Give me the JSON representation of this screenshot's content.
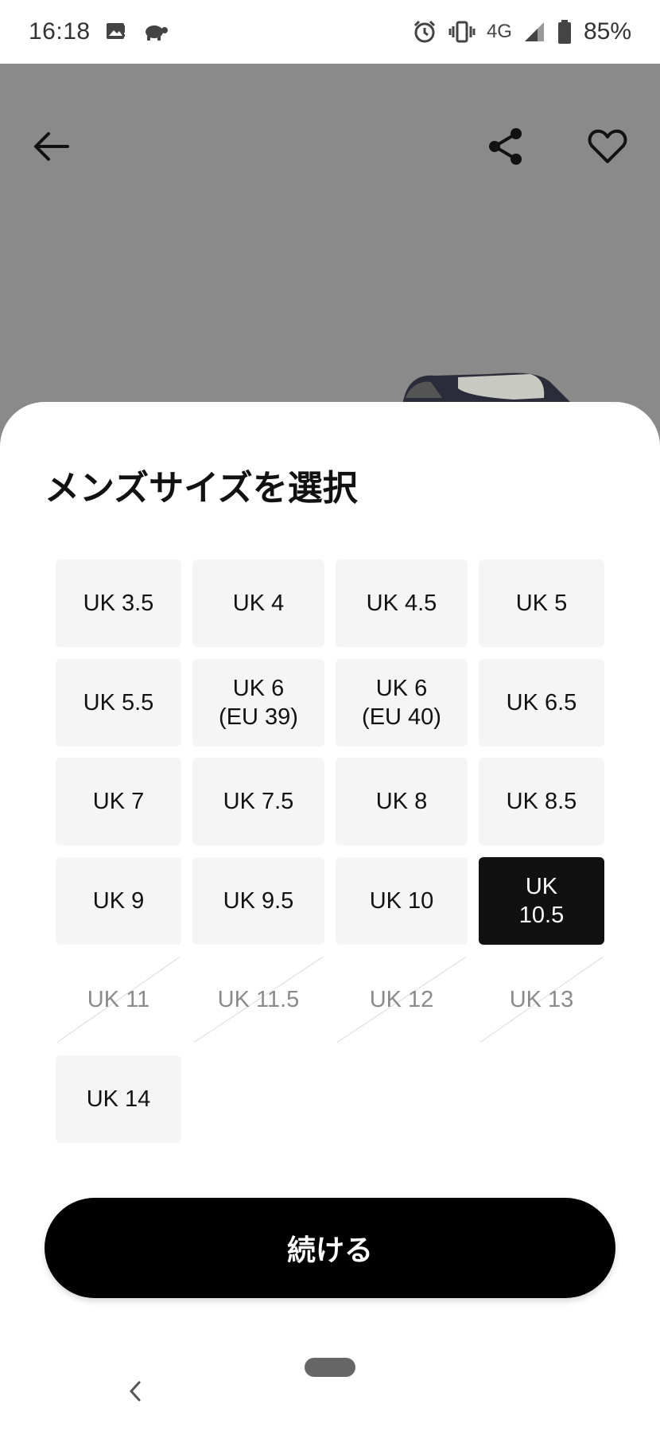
{
  "status_bar": {
    "time": "16:18",
    "network": "4G",
    "battery": "85%",
    "icons": [
      "image-icon",
      "turtle-icon",
      "alarm-icon",
      "vibrate-icon",
      "signal-icon",
      "battery-icon"
    ]
  },
  "hero": {
    "icons": [
      "arrow-left-icon",
      "share-icon",
      "heart-outline-icon"
    ]
  },
  "sheet": {
    "title": "メンズサイズを選択",
    "sizes": [
      {
        "label": "UK 3.5",
        "state": "available"
      },
      {
        "label": "UK 4",
        "state": "available"
      },
      {
        "label": "UK 4.5",
        "state": "available"
      },
      {
        "label": "UK 5",
        "state": "available"
      },
      {
        "label": "UK 5.5",
        "state": "available"
      },
      {
        "label": "UK 6\n(EU 39)",
        "state": "available"
      },
      {
        "label": "UK 6\n(EU 40)",
        "state": "available"
      },
      {
        "label": "UK 6.5",
        "state": "available"
      },
      {
        "label": "UK 7",
        "state": "available"
      },
      {
        "label": "UK 7.5",
        "state": "available"
      },
      {
        "label": "UK 8",
        "state": "available"
      },
      {
        "label": "UK 8.5",
        "state": "available"
      },
      {
        "label": "UK 9",
        "state": "available"
      },
      {
        "label": "UK 9.5",
        "state": "available"
      },
      {
        "label": "UK 10",
        "state": "available"
      },
      {
        "label": "UK\n10.5",
        "state": "selected"
      },
      {
        "label": "UK 11",
        "state": "sold-out"
      },
      {
        "label": "UK 11.5",
        "state": "sold-out"
      },
      {
        "label": "UK 12",
        "state": "sold-out"
      },
      {
        "label": "UK 13",
        "state": "sold-out"
      },
      {
        "label": "UK 14",
        "state": "available"
      }
    ],
    "continue_label": "続ける"
  },
  "colors": {
    "selected_bg": "#111111",
    "tile_bg": "#f5f5f5",
    "disabled_text": "#8a8a8a",
    "hero_bg": "#8a8a8a"
  }
}
